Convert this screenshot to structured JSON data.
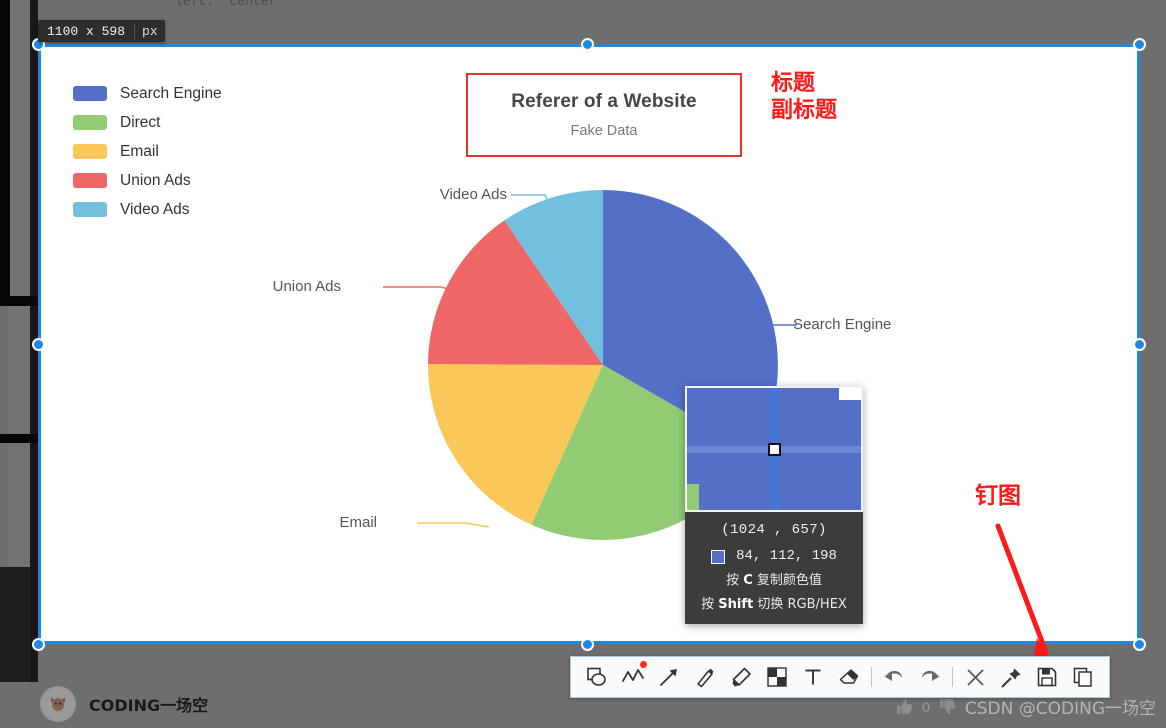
{
  "capture": {
    "size_label": "1100 x 598",
    "size_unit": "px"
  },
  "background": {
    "ghost_code": "left: 'center'"
  },
  "chart_data": {
    "type": "pie",
    "title": "Referer of a Website",
    "subtitle": "Fake Data",
    "legend_position": "top-left",
    "categories": [
      "Search Engine",
      "Direct",
      "Email",
      "Union Ads",
      "Video Ads"
    ],
    "values": [
      1048,
      735,
      580,
      484,
      300
    ],
    "percentages": [
      33.3,
      23.4,
      18.4,
      15.4,
      9.5
    ],
    "colors": [
      "#5470c6",
      "#91cc75",
      "#fac858",
      "#ee6666",
      "#73c0de"
    ],
    "labels": [
      {
        "name": "Search Engine",
        "side": "right"
      },
      {
        "name": "Direct",
        "side": "right"
      },
      {
        "name": "Email",
        "side": "left"
      },
      {
        "name": "Union Ads",
        "side": "left"
      },
      {
        "name": "Video Ads",
        "side": "left"
      }
    ]
  },
  "legend": {
    "items": [
      {
        "label": "Search Engine",
        "color": "#5470c6"
      },
      {
        "label": "Direct",
        "color": "#91cc75"
      },
      {
        "label": "Email",
        "color": "#fac858"
      },
      {
        "label": "Union Ads",
        "color": "#ee6666"
      },
      {
        "label": "Video Ads",
        "color": "#73c0de"
      }
    ]
  },
  "annotations": {
    "title_note_line1": "标题",
    "title_note_line2": "副标题",
    "pin_note": "钉图",
    "accent_color": "#ff1a1a"
  },
  "color_picker": {
    "coordinate": "(1024 , 657)",
    "rgb": "84, 112, 198",
    "swatch_hex": "#5470c6",
    "hint_copy_prefix": "按 ",
    "hint_copy_key": "C",
    "hint_copy_suffix": " 复制颜色值",
    "hint_toggle_prefix": "按 ",
    "hint_toggle_key": "Shift",
    "hint_toggle_suffix": " 切换 RGB/HEX"
  },
  "toolbar": {
    "items": [
      {
        "name": "shapes-tool",
        "icon": "shapes-icon",
        "badge": false
      },
      {
        "name": "polyline-tool",
        "icon": "polyline-icon",
        "badge": true
      },
      {
        "name": "arrow-tool",
        "icon": "arrow-icon",
        "badge": false
      },
      {
        "name": "pencil-tool",
        "icon": "pencil-icon",
        "badge": false
      },
      {
        "name": "marker-tool",
        "icon": "marker-icon",
        "badge": false
      },
      {
        "name": "mosaic-tool",
        "icon": "mosaic-icon",
        "badge": false
      },
      {
        "name": "text-tool",
        "icon": "text-icon",
        "badge": false
      },
      {
        "name": "eraser-tool",
        "icon": "eraser-icon",
        "badge": false
      },
      {
        "name": "undo-button",
        "icon": "undo-icon",
        "badge": false
      },
      {
        "name": "redo-button",
        "icon": "redo-icon",
        "badge": false
      },
      {
        "name": "close-button",
        "icon": "close-icon",
        "badge": false
      },
      {
        "name": "pin-button",
        "icon": "pin-icon",
        "badge": false
      },
      {
        "name": "save-button",
        "icon": "save-icon",
        "badge": false
      },
      {
        "name": "copy-button",
        "icon": "copy-icon",
        "badge": false
      }
    ]
  },
  "bottom_bar": {
    "username": "CODING一场空",
    "like_count": "0",
    "watermark": "CSDN @CODING一场空"
  }
}
